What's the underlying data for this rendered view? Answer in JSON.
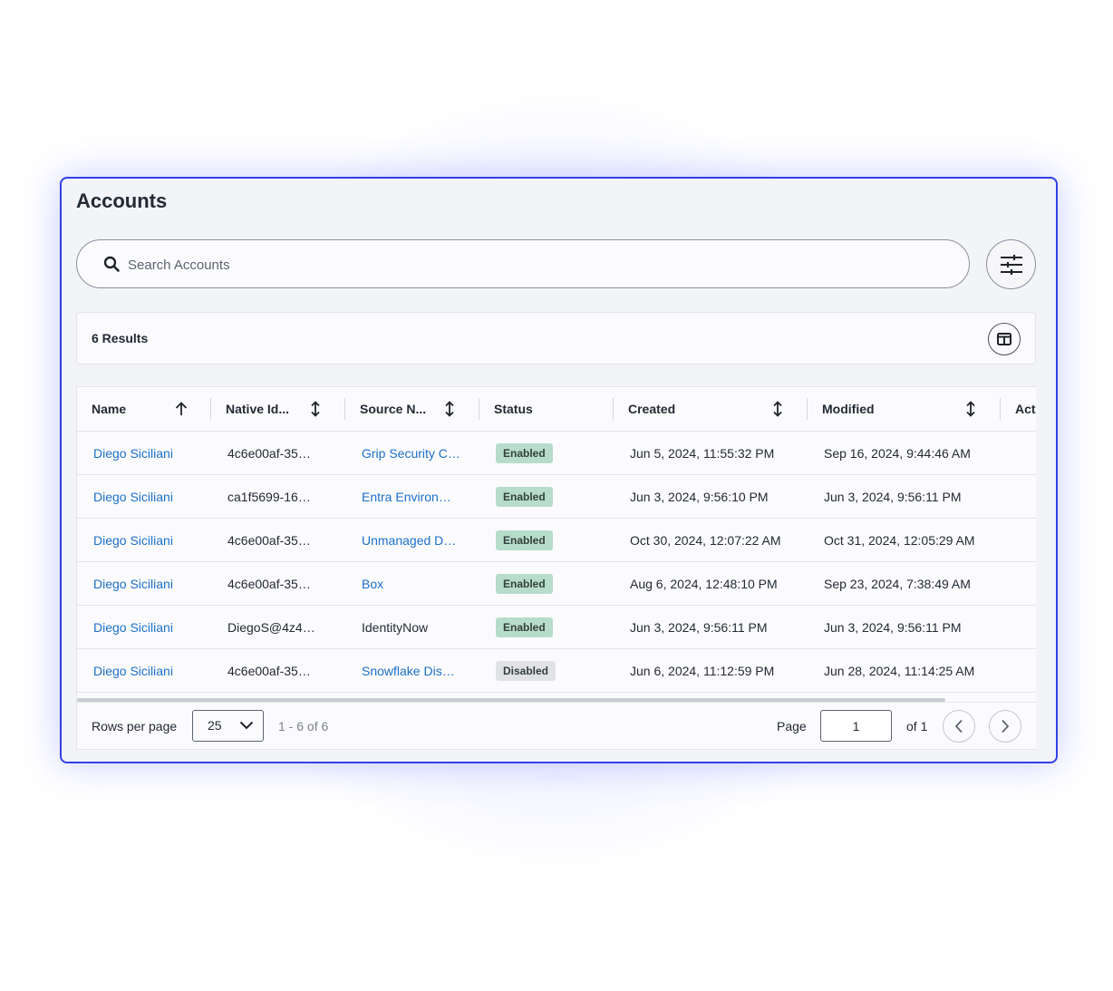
{
  "page": {
    "title": "Accounts",
    "accent_color": "#3340e6"
  },
  "search": {
    "placeholder": "Search Accounts",
    "value": "",
    "icon": "search-icon",
    "filter_icon": "sliders-icon"
  },
  "results": {
    "count_label": "6 Results",
    "columns_icon": "columns-icon"
  },
  "table": {
    "columns": [
      {
        "label": "Name",
        "sort": "ascending"
      },
      {
        "label": "Native Id...",
        "sort": "sortable"
      },
      {
        "label": "Source N...",
        "sort": "sortable"
      },
      {
        "label": "Status",
        "sort": "none"
      },
      {
        "label": "Created",
        "sort": "sortable"
      },
      {
        "label": "Modified",
        "sort": "sortable"
      },
      {
        "label": "Act",
        "sort": "none"
      }
    ],
    "rows": [
      {
        "name": "Diego Siciliani",
        "native_id": "4c6e00af-35…",
        "source": "Grip Security C…",
        "source_link": true,
        "status": "Enabled",
        "created": "Jun 5, 2024, 11:55:32 PM",
        "modified": "Sep 16, 2024, 9:44:46 AM"
      },
      {
        "name": "Diego Siciliani",
        "native_id": "ca1f5699-16…",
        "source": "Entra Environ…",
        "source_link": true,
        "status": "Enabled",
        "created": "Jun 3, 2024, 9:56:10 PM",
        "modified": "Jun 3, 2024, 9:56:11 PM"
      },
      {
        "name": "Diego Siciliani",
        "native_id": "4c6e00af-35…",
        "source": "Unmanaged D…",
        "source_link": true,
        "status": "Enabled",
        "created": "Oct 30, 2024, 12:07:22 AM",
        "modified": "Oct 31, 2024, 12:05:29 AM"
      },
      {
        "name": "Diego Siciliani",
        "native_id": "4c6e00af-35…",
        "source": "Box",
        "source_link": true,
        "status": "Enabled",
        "created": "Aug 6, 2024, 12:48:10 PM",
        "modified": "Sep 23, 2024, 7:38:49 AM"
      },
      {
        "name": "Diego Siciliani",
        "native_id": "DiegoS@4z4…",
        "source": "IdentityNow",
        "source_link": false,
        "status": "Enabled",
        "created": "Jun 3, 2024, 9:56:11 PM",
        "modified": "Jun 3, 2024, 9:56:11 PM"
      },
      {
        "name": "Diego Siciliani",
        "native_id": "4c6e00af-35…",
        "source": "Snowflake Dis…",
        "source_link": true,
        "status": "Disabled",
        "created": "Jun 6, 2024, 11:12:59 PM",
        "modified": "Jun 28, 2024, 11:14:25 AM"
      }
    ],
    "status_colors": {
      "Enabled": "#b7dccc",
      "Disabled": "#e1e2e5"
    }
  },
  "pagination": {
    "rows_per_page_label": "Rows per page",
    "rows_per_page_value": "25",
    "range_label": "1 - 6 of 6",
    "page_label": "Page",
    "page_value": "1",
    "of_label": "of 1",
    "prev_icon": "chevron-left-icon",
    "next_icon": "chevron-right-icon"
  }
}
